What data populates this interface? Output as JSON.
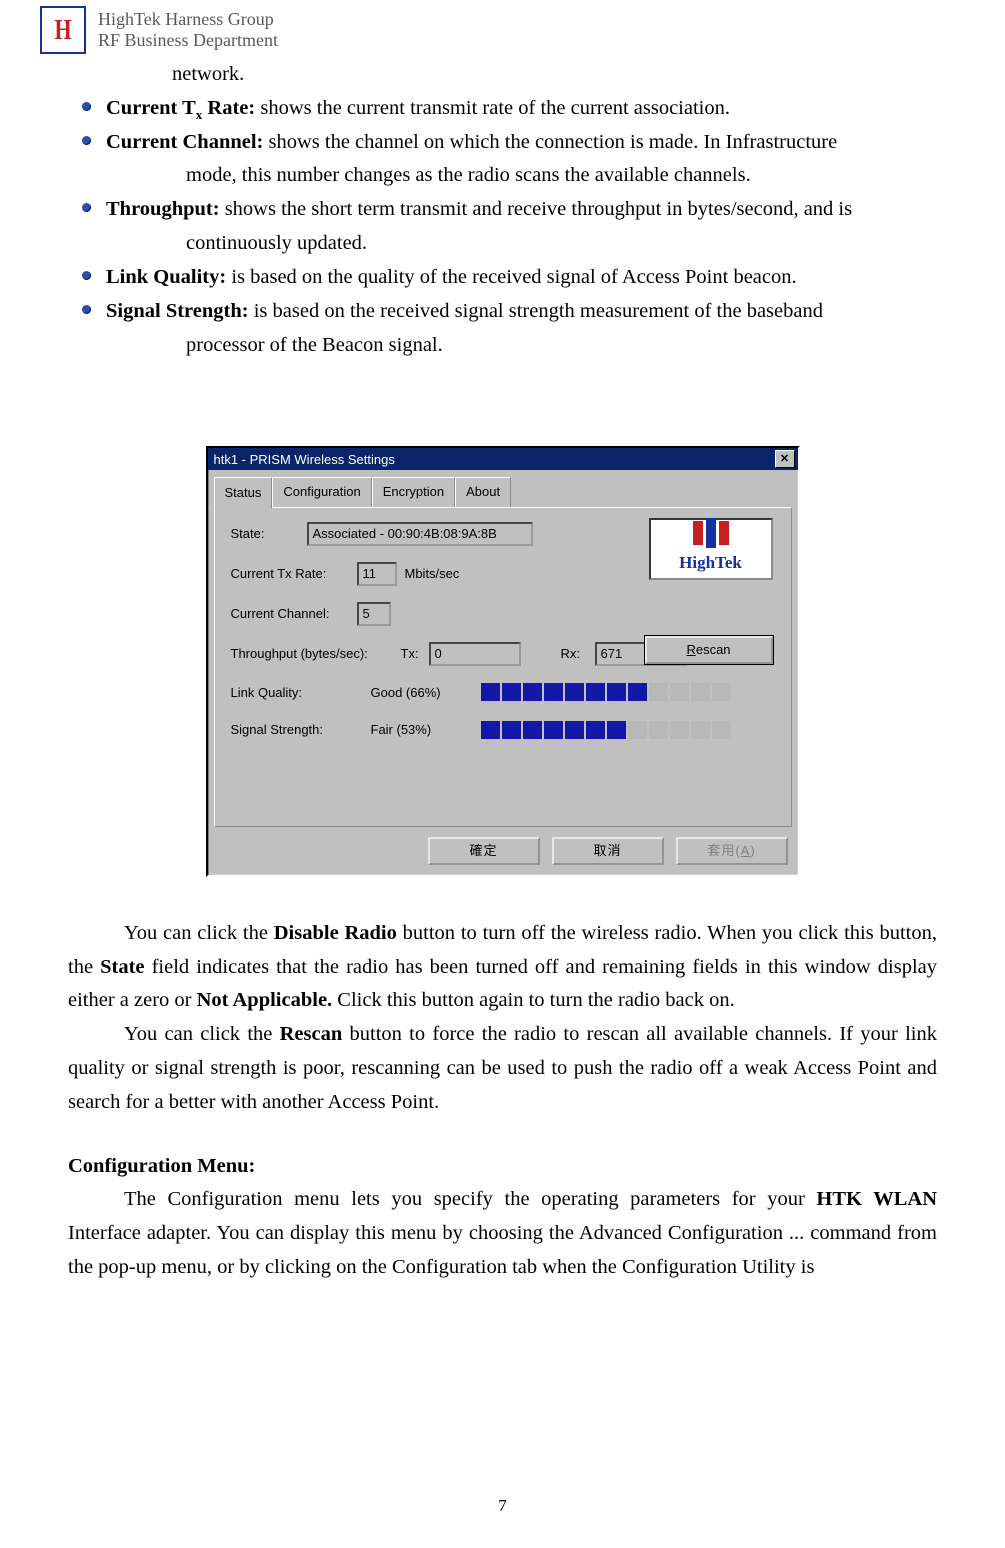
{
  "header": {
    "line1": "HighTek Harness Group",
    "line2": "RF Business Department"
  },
  "intro_tail": "network.",
  "bullets": [
    {
      "label": "Current T",
      "sub": "x",
      "label2": " Rate:",
      "text": " shows the current transmit rate of the current association."
    },
    {
      "label": "Current Channel:",
      "text": " shows the channel on which the connection is made. In Infrastructure",
      "cont": "mode, this number changes as the radio scans the available channels."
    },
    {
      "label": "Throughput:",
      "text": " shows the short term transmit and receive throughput in bytes/second, and is",
      "cont": "continuously updated."
    },
    {
      "label": "Link Quality:",
      "text": " is based on the quality of the received signal of Access Point beacon."
    },
    {
      "label": "Signal Strength:",
      "text": " is based on the received signal strength measurement of the baseband",
      "cont": "processor of the Beacon signal."
    }
  ],
  "dialog": {
    "title": "htk1 - PRISM Wireless Settings",
    "tabs": [
      "Status",
      "Configuration",
      "Encryption",
      "About"
    ],
    "active_tab": 0,
    "state_label": "State:",
    "state_value": "Associated - 00:90:4B:08:9A:8B",
    "txrate_label": "Current Tx Rate:",
    "txrate_value": "11",
    "txrate_unit": "Mbits/sec",
    "channel_label": "Current Channel:",
    "channel_value": "5",
    "rescan": "Rescan",
    "throughput_label": "Throughput (bytes/sec):",
    "tx_label": "Tx:",
    "tx_value": "0",
    "rx_label": "Rx:",
    "rx_value": "671",
    "lq_label": "Link Quality:",
    "lq_value": "Good (66%)",
    "lq_segments_on": 8,
    "lq_segments_total": 12,
    "ss_label": "Signal Strength:",
    "ss_value": "Fair (53%)",
    "ss_segments_on": 7,
    "ss_segments_total": 12,
    "ok": "確定",
    "cancel": "取消",
    "apply": "套用(A)",
    "brand": "HighTek"
  },
  "para1_a": "You can click the ",
  "para1_b": "Disable Radio",
  "para1_c": " button to turn off the wireless radio. When you click this button, the  ",
  "para1_d": "State",
  "para1_e": "  field indicates that the radio has been turned off and remaining fields in this window display either a zero or ",
  "para1_f": "Not Applicable.",
  "para1_g": " Click this button again to turn the radio back on.",
  "para2_a": "You can click the ",
  "para2_b": "Rescan",
  "para2_c": " button to force the radio to rescan all available channels. If your link quality or signal strength is poor, rescanning can be used to push the radio off a weak Access Point and search for a better with another Access Point.",
  "section_title": "Configuration Menu:",
  "para3_a": "The Configuration menu lets you specify the operating parameters for your  ",
  "para3_b": "HTK WLAN",
  "para3_c": " Interface adapter. You can display this menu by choosing the Advanced Configuration ... command from the pop-up menu, or by clicking  on the Configuration tab when the Configuration Utility is",
  "page_number": "7"
}
